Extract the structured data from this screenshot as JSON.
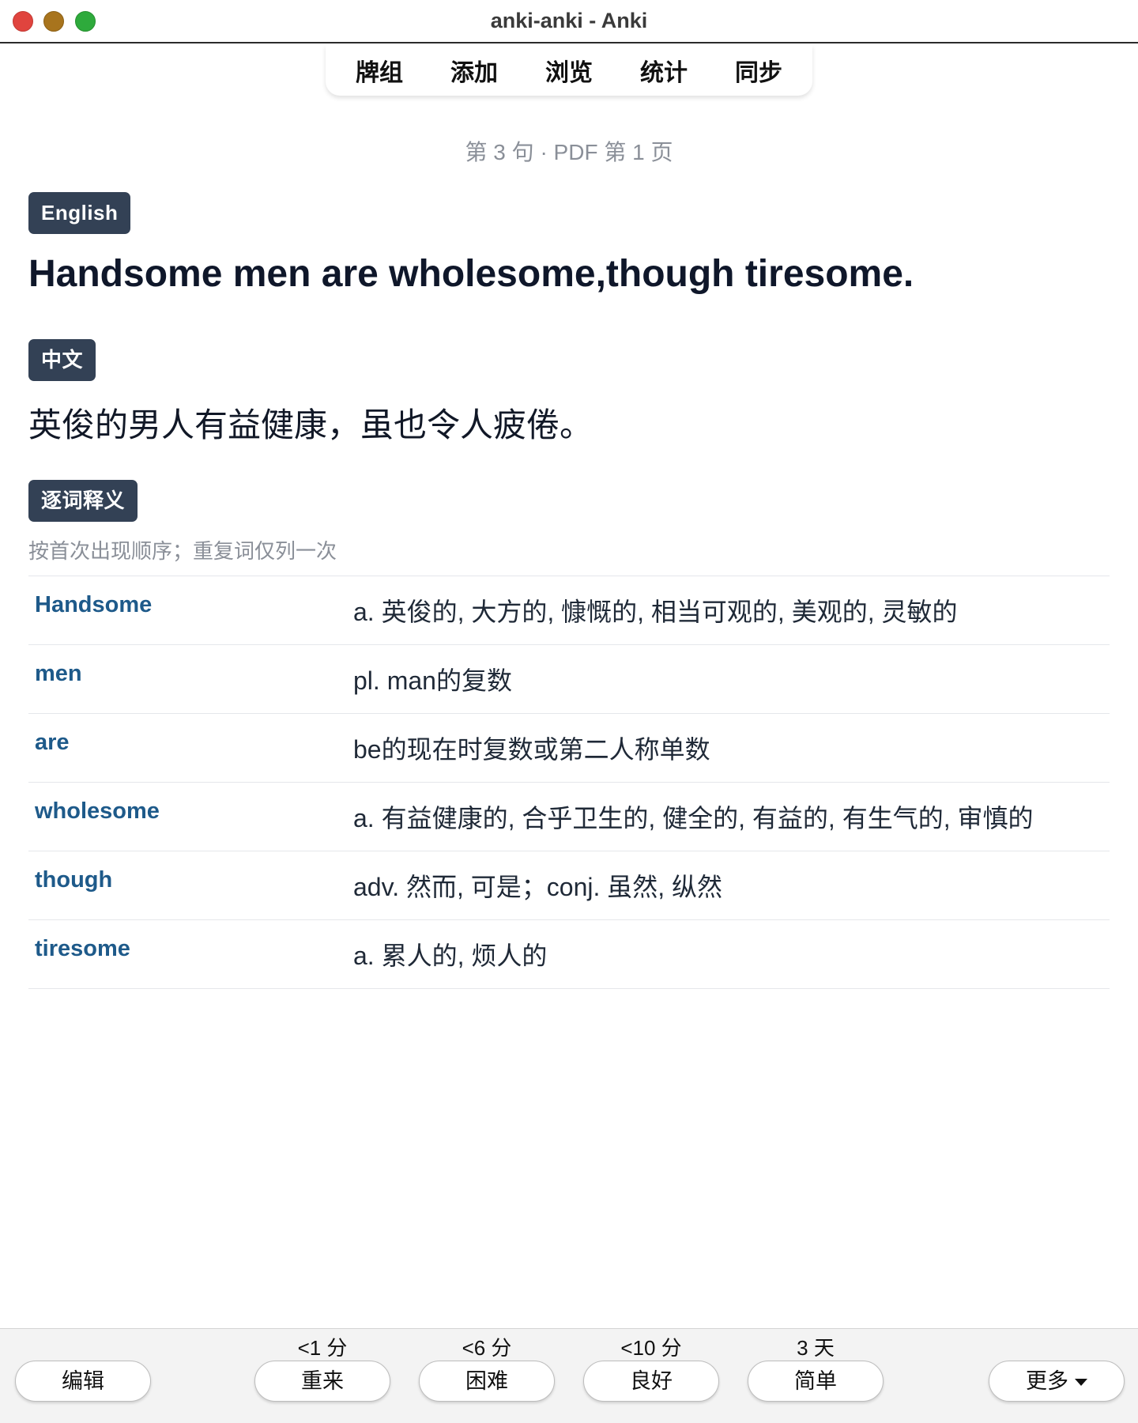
{
  "window": {
    "title": "anki-anki - Anki"
  },
  "nav": {
    "items": [
      "牌组",
      "添加",
      "浏览",
      "统计",
      "同步"
    ]
  },
  "card": {
    "meta": "第 3 句 · PDF 第 1 页",
    "english_label": "English",
    "english_sentence": "Handsome men are wholesome,though tiresome.",
    "chinese_label": "中文",
    "chinese_sentence": "英俊的男人有益健康，虽也令人疲倦。",
    "gloss_label": "逐词释义",
    "gloss_note": "按首次出现顺序；重复词仅列一次",
    "glosses": [
      {
        "word": "Handsome",
        "definition": "a. 英俊的, 大方的, 慷慨的, 相当可观的, 美观的, 灵敏的"
      },
      {
        "word": "men",
        "definition": "pl. man的复数"
      },
      {
        "word": "are",
        "definition": "be的现在时复数或第二人称单数"
      },
      {
        "word": "wholesome",
        "definition": "a. 有益健康的, 合乎卫生的, 健全的, 有益的, 有生气的, 审慎的"
      },
      {
        "word": "though",
        "definition": "adv. 然而, 可是；conj. 虽然, 纵然"
      },
      {
        "word": "tiresome",
        "definition": "a. 累人的, 烦人的"
      }
    ]
  },
  "bottombar": {
    "edit_label": "编辑",
    "more_label": "更多",
    "answers": [
      {
        "label": "重来",
        "time": "<1 分"
      },
      {
        "label": "困难",
        "time": "<6 分"
      },
      {
        "label": "良好",
        "time": "<10 分"
      },
      {
        "label": "简单",
        "time": "3 天"
      }
    ]
  },
  "colors": {
    "badge": "#334155",
    "gloss_word": "#1e5a8a"
  }
}
